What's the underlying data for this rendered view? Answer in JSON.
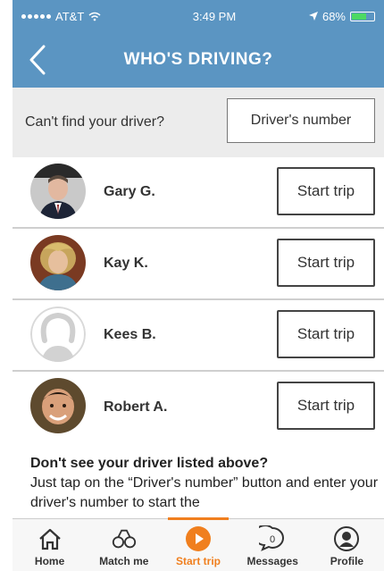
{
  "status_bar": {
    "carrier": "AT&T",
    "time": "3:49 PM",
    "battery": "68%",
    "battery_level": 0.68
  },
  "nav": {
    "title": "WHO'S DRIVING?"
  },
  "find": {
    "prompt": "Can't find your driver?",
    "button_label": "Driver's number"
  },
  "drivers": [
    {
      "name": "Gary G.",
      "button_label": "Start trip"
    },
    {
      "name": "Kay K.",
      "button_label": "Start trip"
    },
    {
      "name": "Kees B.",
      "button_label": "Start trip"
    },
    {
      "name": "Robert A.",
      "button_label": "Start trip"
    }
  ],
  "info": {
    "heading": "Don't see your driver listed above?",
    "body": "Just tap on the “Driver's number” button and enter your driver's number to start the"
  },
  "tabs": [
    {
      "label": "Home",
      "icon": "home-icon"
    },
    {
      "label": "Match me",
      "icon": "match-icon"
    },
    {
      "label": "Start trip",
      "icon": "play-icon"
    },
    {
      "label": "Messages",
      "icon": "messages-icon"
    },
    {
      "label": "Profile",
      "icon": "profile-icon"
    }
  ],
  "colors": {
    "header": "#5b95c2",
    "accent": "#f07f1e",
    "find_bar": "#ececec"
  }
}
